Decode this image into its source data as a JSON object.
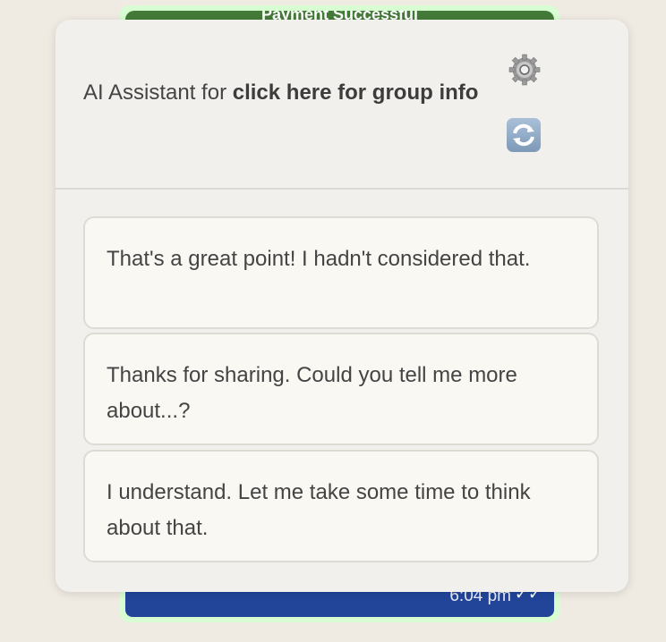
{
  "background_message": {
    "banner_text": "Payment Successful",
    "time": "6:04 pm",
    "status_icon": "double-check-icon"
  },
  "assistant": {
    "title_prefix": "AI Assistant for ",
    "title_link": "click here for group info",
    "settings_icon": "gear-icon",
    "refresh_icon": "refresh-icon",
    "suggestions": [
      "That's a great point! I hadn't considered that.",
      "Thanks for sharing. Could you tell me more about...?",
      "I understand. Let me take some time to think about that."
    ]
  }
}
